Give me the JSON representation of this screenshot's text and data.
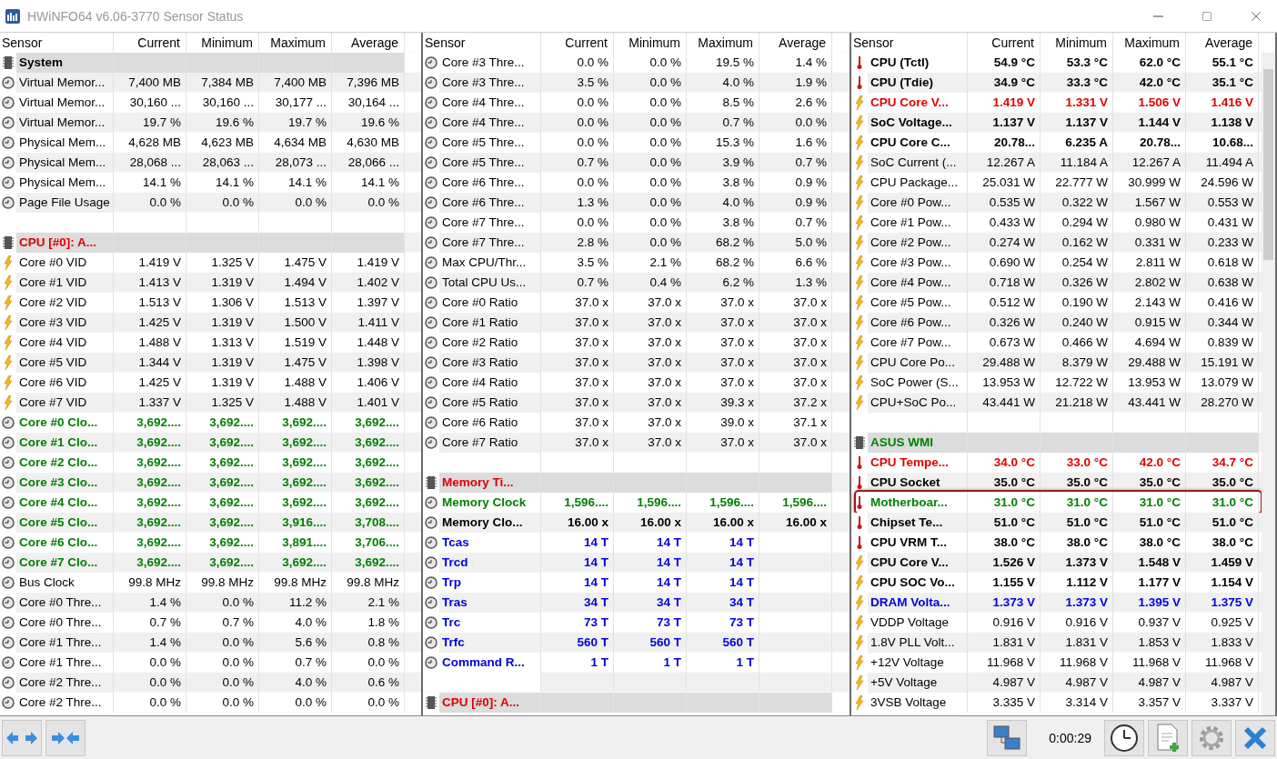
{
  "window": {
    "title": "HWiNFO64 v6.06-3770 Sensor Status"
  },
  "panels": [
    {
      "columns": [
        "Sensor",
        "Current",
        "Minimum",
        "Maximum",
        "Average"
      ],
      "rows": [
        {
          "kind": "header",
          "label": "System",
          "color": "#000000"
        },
        {
          "kind": "clock",
          "label": "Virtual Memor...",
          "values": [
            "7,400 MB",
            "7,384 MB",
            "7,400 MB",
            "7,396 MB"
          ],
          "color": "#000000",
          "bold": false
        },
        {
          "kind": "clock",
          "label": "Virtual Memor...",
          "values": [
            "30,160 ...",
            "30,160 ...",
            "30,177 ...",
            "30,164 ..."
          ],
          "color": "#000000",
          "bold": false
        },
        {
          "kind": "clock",
          "label": "Virtual Memor...",
          "values": [
            "19.7 %",
            "19.6 %",
            "19.7 %",
            "19.6 %"
          ],
          "color": "#000000",
          "bold": false
        },
        {
          "kind": "clock",
          "label": "Physical Mem...",
          "values": [
            "4,628 MB",
            "4,623 MB",
            "4,634 MB",
            "4,630 MB"
          ],
          "color": "#000000",
          "bold": false
        },
        {
          "kind": "clock",
          "label": "Physical Mem...",
          "values": [
            "28,068 ...",
            "28,063 ...",
            "28,073 ...",
            "28,066 ..."
          ],
          "color": "#000000",
          "bold": false
        },
        {
          "kind": "clock",
          "label": "Physical Mem...",
          "values": [
            "14.1 %",
            "14.1 %",
            "14.1 %",
            "14.1 %"
          ],
          "color": "#000000",
          "bold": false
        },
        {
          "kind": "clock",
          "label": "Page File Usage",
          "values": [
            "0.0 %",
            "0.0 %",
            "0.0 %",
            "0.0 %"
          ],
          "color": "#000000",
          "bold": false
        },
        {
          "kind": "blank"
        },
        {
          "kind": "header",
          "label": "CPU [#0]: A...",
          "color": "#e00000"
        },
        {
          "kind": "power",
          "label": "Core #0 VID",
          "values": [
            "1.419 V",
            "1.325 V",
            "1.475 V",
            "1.419 V"
          ],
          "color": "#000000",
          "bold": false
        },
        {
          "kind": "power",
          "label": "Core #1 VID",
          "values": [
            "1.413 V",
            "1.319 V",
            "1.494 V",
            "1.402 V"
          ],
          "color": "#000000",
          "bold": false
        },
        {
          "kind": "power",
          "label": "Core #2 VID",
          "values": [
            "1.513 V",
            "1.306 V",
            "1.513 V",
            "1.397 V"
          ],
          "color": "#000000",
          "bold": false
        },
        {
          "kind": "power",
          "label": "Core #3 VID",
          "values": [
            "1.425 V",
            "1.319 V",
            "1.500 V",
            "1.411 V"
          ],
          "color": "#000000",
          "bold": false
        },
        {
          "kind": "power",
          "label": "Core #4 VID",
          "values": [
            "1.488 V",
            "1.313 V",
            "1.519 V",
            "1.448 V"
          ],
          "color": "#000000",
          "bold": false
        },
        {
          "kind": "power",
          "label": "Core #5 VID",
          "values": [
            "1.344 V",
            "1.319 V",
            "1.475 V",
            "1.398 V"
          ],
          "color": "#000000",
          "bold": false
        },
        {
          "kind": "power",
          "label": "Core #6 VID",
          "values": [
            "1.425 V",
            "1.319 V",
            "1.488 V",
            "1.406 V"
          ],
          "color": "#000000",
          "bold": false
        },
        {
          "kind": "power",
          "label": "Core #7 VID",
          "values": [
            "1.337 V",
            "1.325 V",
            "1.488 V",
            "1.401 V"
          ],
          "color": "#000000",
          "bold": false
        },
        {
          "kind": "clock",
          "label": "Core #0 Clo...",
          "values": [
            "3,692....",
            "3,692....",
            "3,692....",
            "3,692...."
          ],
          "color": "#008000",
          "bold": true
        },
        {
          "kind": "clock",
          "label": "Core #1 Clo...",
          "values": [
            "3,692....",
            "3,692....",
            "3,692....",
            "3,692...."
          ],
          "color": "#008000",
          "bold": true
        },
        {
          "kind": "clock",
          "label": "Core #2 Clo...",
          "values": [
            "3,692....",
            "3,692....",
            "3,692....",
            "3,692...."
          ],
          "color": "#008000",
          "bold": true
        },
        {
          "kind": "clock",
          "label": "Core #3 Clo...",
          "values": [
            "3,692....",
            "3,692....",
            "3,692....",
            "3,692...."
          ],
          "color": "#008000",
          "bold": true
        },
        {
          "kind": "clock",
          "label": "Core #4 Clo...",
          "values": [
            "3,692....",
            "3,692....",
            "3,692....",
            "3,692...."
          ],
          "color": "#008000",
          "bold": true
        },
        {
          "kind": "clock",
          "label": "Core #5 Clo...",
          "values": [
            "3,692....",
            "3,692....",
            "3,916....",
            "3,708...."
          ],
          "color": "#008000",
          "bold": true
        },
        {
          "kind": "clock",
          "label": "Core #6 Clo...",
          "values": [
            "3,692....",
            "3,692....",
            "3,891....",
            "3,706...."
          ],
          "color": "#008000",
          "bold": true
        },
        {
          "kind": "clock",
          "label": "Core #7 Clo...",
          "values": [
            "3,692....",
            "3,692....",
            "3,692....",
            "3,692...."
          ],
          "color": "#008000",
          "bold": true
        },
        {
          "kind": "clock",
          "label": "Bus Clock",
          "values": [
            "99.8 MHz",
            "99.8 MHz",
            "99.8 MHz",
            "99.8 MHz"
          ],
          "color": "#000000",
          "bold": false
        },
        {
          "kind": "clock",
          "label": "Core #0 Thre...",
          "values": [
            "1.4 %",
            "0.0 %",
            "11.2 %",
            "2.1 %"
          ],
          "color": "#000000",
          "bold": false
        },
        {
          "kind": "clock",
          "label": "Core #0 Thre...",
          "values": [
            "0.7 %",
            "0.7 %",
            "4.0 %",
            "1.8 %"
          ],
          "color": "#000000",
          "bold": false
        },
        {
          "kind": "clock",
          "label": "Core #1 Thre...",
          "values": [
            "1.4 %",
            "0.0 %",
            "5.6 %",
            "0.8 %"
          ],
          "color": "#000000",
          "bold": false
        },
        {
          "kind": "clock",
          "label": "Core #1 Thre...",
          "values": [
            "0.0 %",
            "0.0 %",
            "0.7 %",
            "0.0 %"
          ],
          "color": "#000000",
          "bold": false
        },
        {
          "kind": "clock",
          "label": "Core #2 Thre...",
          "values": [
            "0.0 %",
            "0.0 %",
            "4.0 %",
            "0.6 %"
          ],
          "color": "#000000",
          "bold": false
        },
        {
          "kind": "clock",
          "label": "Core #2 Thre...",
          "values": [
            "0.0 %",
            "0.0 %",
            "0.0 %",
            "0.0 %"
          ],
          "color": "#000000",
          "bold": false
        }
      ]
    },
    {
      "columns": [
        "Sensor",
        "Current",
        "Minimum",
        "Maximum",
        "Average"
      ],
      "rows": [
        {
          "kind": "clock",
          "label": "Core #3 Thre...",
          "values": [
            "0.0 %",
            "0.0 %",
            "19.5 %",
            "1.4 %"
          ],
          "color": "#000000",
          "bold": false
        },
        {
          "kind": "clock",
          "label": "Core #3 Thre...",
          "values": [
            "3.5 %",
            "0.0 %",
            "4.0 %",
            "1.9 %"
          ],
          "color": "#000000",
          "bold": false
        },
        {
          "kind": "clock",
          "label": "Core #4 Thre...",
          "values": [
            "0.0 %",
            "0.0 %",
            "8.5 %",
            "2.6 %"
          ],
          "color": "#000000",
          "bold": false
        },
        {
          "kind": "clock",
          "label": "Core #4 Thre...",
          "values": [
            "0.0 %",
            "0.0 %",
            "0.7 %",
            "0.0 %"
          ],
          "color": "#000000",
          "bold": false
        },
        {
          "kind": "clock",
          "label": "Core #5 Thre...",
          "values": [
            "0.0 %",
            "0.0 %",
            "15.3 %",
            "1.6 %"
          ],
          "color": "#000000",
          "bold": false
        },
        {
          "kind": "clock",
          "label": "Core #5 Thre...",
          "values": [
            "0.7 %",
            "0.0 %",
            "3.9 %",
            "0.7 %"
          ],
          "color": "#000000",
          "bold": false
        },
        {
          "kind": "clock",
          "label": "Core #6 Thre...",
          "values": [
            "0.0 %",
            "0.0 %",
            "3.8 %",
            "0.9 %"
          ],
          "color": "#000000",
          "bold": false
        },
        {
          "kind": "clock",
          "label": "Core #6 Thre...",
          "values": [
            "1.3 %",
            "0.0 %",
            "4.0 %",
            "0.9 %"
          ],
          "color": "#000000",
          "bold": false
        },
        {
          "kind": "clock",
          "label": "Core #7 Thre...",
          "values": [
            "0.0 %",
            "0.0 %",
            "3.8 %",
            "0.7 %"
          ],
          "color": "#000000",
          "bold": false
        },
        {
          "kind": "clock",
          "label": "Core #7 Thre...",
          "values": [
            "2.8 %",
            "0.0 %",
            "68.2 %",
            "5.0 %"
          ],
          "color": "#000000",
          "bold": false
        },
        {
          "kind": "clock",
          "label": "Max CPU/Thr...",
          "values": [
            "3.5 %",
            "2.1 %",
            "68.2 %",
            "6.6 %"
          ],
          "color": "#000000",
          "bold": false
        },
        {
          "kind": "clock",
          "label": "Total CPU Us...",
          "values": [
            "0.7 %",
            "0.4 %",
            "6.2 %",
            "1.3 %"
          ],
          "color": "#000000",
          "bold": false
        },
        {
          "kind": "clock",
          "label": "Core #0 Ratio",
          "values": [
            "37.0 x",
            "37.0 x",
            "37.0 x",
            "37.0 x"
          ],
          "color": "#000000",
          "bold": false
        },
        {
          "kind": "clock",
          "label": "Core #1 Ratio",
          "values": [
            "37.0 x",
            "37.0 x",
            "37.0 x",
            "37.0 x"
          ],
          "color": "#000000",
          "bold": false
        },
        {
          "kind": "clock",
          "label": "Core #2 Ratio",
          "values": [
            "37.0 x",
            "37.0 x",
            "37.0 x",
            "37.0 x"
          ],
          "color": "#000000",
          "bold": false
        },
        {
          "kind": "clock",
          "label": "Core #3 Ratio",
          "values": [
            "37.0 x",
            "37.0 x",
            "37.0 x",
            "37.0 x"
          ],
          "color": "#000000",
          "bold": false
        },
        {
          "kind": "clock",
          "label": "Core #4 Ratio",
          "values": [
            "37.0 x",
            "37.0 x",
            "37.0 x",
            "37.0 x"
          ],
          "color": "#000000",
          "bold": false
        },
        {
          "kind": "clock",
          "label": "Core #5 Ratio",
          "values": [
            "37.0 x",
            "37.0 x",
            "39.3 x",
            "37.2 x"
          ],
          "color": "#000000",
          "bold": false
        },
        {
          "kind": "clock",
          "label": "Core #6 Ratio",
          "values": [
            "37.0 x",
            "37.0 x",
            "39.0 x",
            "37.1 x"
          ],
          "color": "#000000",
          "bold": false
        },
        {
          "kind": "clock",
          "label": "Core #7 Ratio",
          "values": [
            "37.0 x",
            "37.0 x",
            "37.0 x",
            "37.0 x"
          ],
          "color": "#000000",
          "bold": false
        },
        {
          "kind": "blank"
        },
        {
          "kind": "header",
          "label": "Memory Ti...",
          "color": "#e00000"
        },
        {
          "kind": "clock",
          "label": "Memory Clock",
          "values": [
            "1,596....",
            "1,596....",
            "1,596....",
            "1,596...."
          ],
          "color": "#008000",
          "bold": true
        },
        {
          "kind": "clock",
          "label": "Memory Clo...",
          "values": [
            "16.00 x",
            "16.00 x",
            "16.00 x",
            "16.00 x"
          ],
          "color": "#000000",
          "bold": true
        },
        {
          "kind": "clock",
          "label": "Tcas",
          "values": [
            "14 T",
            "14 T",
            "14 T"
          ],
          "color": "#0000e0",
          "bold": true
        },
        {
          "kind": "clock",
          "label": "Trcd",
          "values": [
            "14 T",
            "14 T",
            "14 T"
          ],
          "color": "#0000e0",
          "bold": true
        },
        {
          "kind": "clock",
          "label": "Trp",
          "values": [
            "14 T",
            "14 T",
            "14 T"
          ],
          "color": "#0000e0",
          "bold": true
        },
        {
          "kind": "clock",
          "label": "Tras",
          "values": [
            "34 T",
            "34 T",
            "34 T"
          ],
          "color": "#0000e0",
          "bold": true
        },
        {
          "kind": "clock",
          "label": "Trc",
          "values": [
            "73 T",
            "73 T",
            "73 T"
          ],
          "color": "#0000e0",
          "bold": true
        },
        {
          "kind": "clock",
          "label": "Trfc",
          "values": [
            "560 T",
            "560 T",
            "560 T"
          ],
          "color": "#0000e0",
          "bold": true
        },
        {
          "kind": "clock",
          "label": "Command R...",
          "values": [
            "1 T",
            "1 T",
            "1 T"
          ],
          "color": "#0000e0",
          "bold": true
        },
        {
          "kind": "blank"
        },
        {
          "kind": "header",
          "label": "CPU [#0]: A...",
          "color": "#e00000"
        }
      ]
    },
    {
      "columns": [
        "Sensor",
        "Current",
        "Minimum",
        "Maximum",
        "Average"
      ],
      "rows": [
        {
          "kind": "temperature",
          "label": "CPU (Tctl)",
          "values": [
            "54.9 °C",
            "53.3 °C",
            "62.0 °C",
            "55.1 °C"
          ],
          "color": "#000000",
          "bold": true
        },
        {
          "kind": "temperature",
          "label": "CPU (Tdie)",
          "values": [
            "34.9 °C",
            "33.3 °C",
            "42.0 °C",
            "35.1 °C"
          ],
          "color": "#000000",
          "bold": true
        },
        {
          "kind": "power",
          "label": "CPU Core V...",
          "values": [
            "1.419 V",
            "1.331 V",
            "1.506 V",
            "1.416 V"
          ],
          "color": "#e00000",
          "bold": true
        },
        {
          "kind": "power",
          "label": "SoC Voltage...",
          "values": [
            "1.137 V",
            "1.137 V",
            "1.144 V",
            "1.138 V"
          ],
          "color": "#000000",
          "bold": true
        },
        {
          "kind": "power",
          "label": "CPU Core C...",
          "values": [
            "20.78...",
            "6.235 A",
            "20.78...",
            "10.68..."
          ],
          "color": "#000000",
          "bold": true
        },
        {
          "kind": "power",
          "label": "SoC Current (...",
          "values": [
            "12.267 A",
            "11.184 A",
            "12.267 A",
            "11.494 A"
          ],
          "color": "#000000",
          "bold": false
        },
        {
          "kind": "power",
          "label": "CPU Package...",
          "values": [
            "25.031 W",
            "22.777 W",
            "30.999 W",
            "24.596 W"
          ],
          "color": "#000000",
          "bold": false
        },
        {
          "kind": "power",
          "label": "Core #0 Pow...",
          "values": [
            "0.535 W",
            "0.322 W",
            "1.567 W",
            "0.553 W"
          ],
          "color": "#000000",
          "bold": false
        },
        {
          "kind": "power",
          "label": "Core #1 Pow...",
          "values": [
            "0.433 W",
            "0.294 W",
            "0.980 W",
            "0.431 W"
          ],
          "color": "#000000",
          "bold": false
        },
        {
          "kind": "power",
          "label": "Core #2 Pow...",
          "values": [
            "0.274 W",
            "0.162 W",
            "0.331 W",
            "0.233 W"
          ],
          "color": "#000000",
          "bold": false
        },
        {
          "kind": "power",
          "label": "Core #3 Pow...",
          "values": [
            "0.690 W",
            "0.254 W",
            "2.811 W",
            "0.618 W"
          ],
          "color": "#000000",
          "bold": false
        },
        {
          "kind": "power",
          "label": "Core #4 Pow...",
          "values": [
            "0.718 W",
            "0.326 W",
            "2.802 W",
            "0.638 W"
          ],
          "color": "#000000",
          "bold": false
        },
        {
          "kind": "power",
          "label": "Core #5 Pow...",
          "values": [
            "0.512 W",
            "0.190 W",
            "2.143 W",
            "0.416 W"
          ],
          "color": "#000000",
          "bold": false
        },
        {
          "kind": "power",
          "label": "Core #6 Pow...",
          "values": [
            "0.326 W",
            "0.240 W",
            "0.915 W",
            "0.344 W"
          ],
          "color": "#000000",
          "bold": false
        },
        {
          "kind": "power",
          "label": "Core #7 Pow...",
          "values": [
            "0.673 W",
            "0.466 W",
            "4.694 W",
            "0.839 W"
          ],
          "color": "#000000",
          "bold": false
        },
        {
          "kind": "power",
          "label": "CPU Core Po...",
          "values": [
            "29.488 W",
            "8.379 W",
            "29.488 W",
            "15.191 W"
          ],
          "color": "#000000",
          "bold": false
        },
        {
          "kind": "power",
          "label": "SoC Power (S...",
          "values": [
            "13.953 W",
            "12.722 W",
            "13.953 W",
            "13.079 W"
          ],
          "color": "#000000",
          "bold": false
        },
        {
          "kind": "power",
          "label": "CPU+SoC Po...",
          "values": [
            "43.441 W",
            "21.218 W",
            "43.441 W",
            "28.270 W"
          ],
          "color": "#000000",
          "bold": false
        },
        {
          "kind": "blank"
        },
        {
          "kind": "header",
          "label": "ASUS WMI",
          "color": "#008000"
        },
        {
          "kind": "temperature",
          "label": "CPU Tempe...",
          "values": [
            "34.0 °C",
            "33.0 °C",
            "42.0 °C",
            "34.7 °C"
          ],
          "color": "#e00000",
          "bold": true
        },
        {
          "kind": "temperature",
          "label": "CPU Socket",
          "values": [
            "35.0 °C",
            "35.0 °C",
            "35.0 °C",
            "35.0 °C"
          ],
          "color": "#000000",
          "bold": true
        },
        {
          "kind": "temperature",
          "label": "Motherboar...",
          "values": [
            "31.0 °C",
            "31.0 °C",
            "31.0 °C",
            "31.0 °C"
          ],
          "color": "#008000",
          "bold": true,
          "highlighted": true
        },
        {
          "kind": "temperature",
          "label": "Chipset Te...",
          "values": [
            "51.0 °C",
            "51.0 °C",
            "51.0 °C",
            "51.0 °C"
          ],
          "color": "#000000",
          "bold": true
        },
        {
          "kind": "temperature",
          "label": "CPU VRM T...",
          "values": [
            "38.0 °C",
            "38.0 °C",
            "38.0 °C",
            "38.0 °C"
          ],
          "color": "#000000",
          "bold": true
        },
        {
          "kind": "power",
          "label": "CPU Core V...",
          "values": [
            "1.526 V",
            "1.373 V",
            "1.548 V",
            "1.459 V"
          ],
          "color": "#000000",
          "bold": true
        },
        {
          "kind": "power",
          "label": "CPU SOC Vo...",
          "values": [
            "1.155 V",
            "1.112 V",
            "1.177 V",
            "1.154 V"
          ],
          "color": "#000000",
          "bold": true
        },
        {
          "kind": "power",
          "label": "DRAM Volta...",
          "values": [
            "1.373 V",
            "1.373 V",
            "1.395 V",
            "1.375 V"
          ],
          "color": "#0000e0",
          "bold": true
        },
        {
          "kind": "power",
          "label": "VDDP Voltage",
          "values": [
            "0.916 V",
            "0.916 V",
            "0.937 V",
            "0.925 V"
          ],
          "color": "#000000",
          "bold": false
        },
        {
          "kind": "power",
          "label": "1.8V PLL Volt...",
          "values": [
            "1.831 V",
            "1.831 V",
            "1.853 V",
            "1.833 V"
          ],
          "color": "#000000",
          "bold": false
        },
        {
          "kind": "power",
          "label": "+12V Voltage",
          "values": [
            "11.968 V",
            "11.968 V",
            "11.968 V",
            "11.968 V"
          ],
          "color": "#000000",
          "bold": false
        },
        {
          "kind": "power",
          "label": "+5V Voltage",
          "values": [
            "4.987 V",
            "4.987 V",
            "4.987 V",
            "4.987 V"
          ],
          "color": "#000000",
          "bold": false
        },
        {
          "kind": "power",
          "label": "3VSB Voltage",
          "values": [
            "3.335 V",
            "3.314 V",
            "3.357 V",
            "3.337 V"
          ],
          "color": "#000000",
          "bold": false
        }
      ]
    }
  ],
  "status_bar": {
    "elapsed": "0:00:29"
  }
}
